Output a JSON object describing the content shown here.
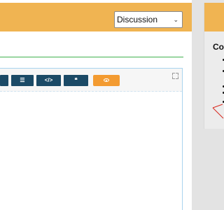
{
  "topbar": {
    "post_type_select": {
      "selected": "Discussion"
    }
  },
  "editor_toolbar": {
    "buttons": [
      {
        "icon": "list-icon",
        "glyph": "☰"
      },
      {
        "icon": "code-icon",
        "glyph": "</>"
      },
      {
        "icon": "quote-icon",
        "glyph": "❝"
      }
    ],
    "preview_icon": "eye-icon",
    "fullscreen_icon": "fullscreen-icon"
  },
  "sidebar": {
    "title": "Co"
  },
  "colors": {
    "header": "#f0b452",
    "toolbar_button": "#1b4a66",
    "preview_button": "#f39b31",
    "title_underline": "#41b24e",
    "editor_border": "#a9d4ee",
    "annotation": "#d9281e"
  }
}
